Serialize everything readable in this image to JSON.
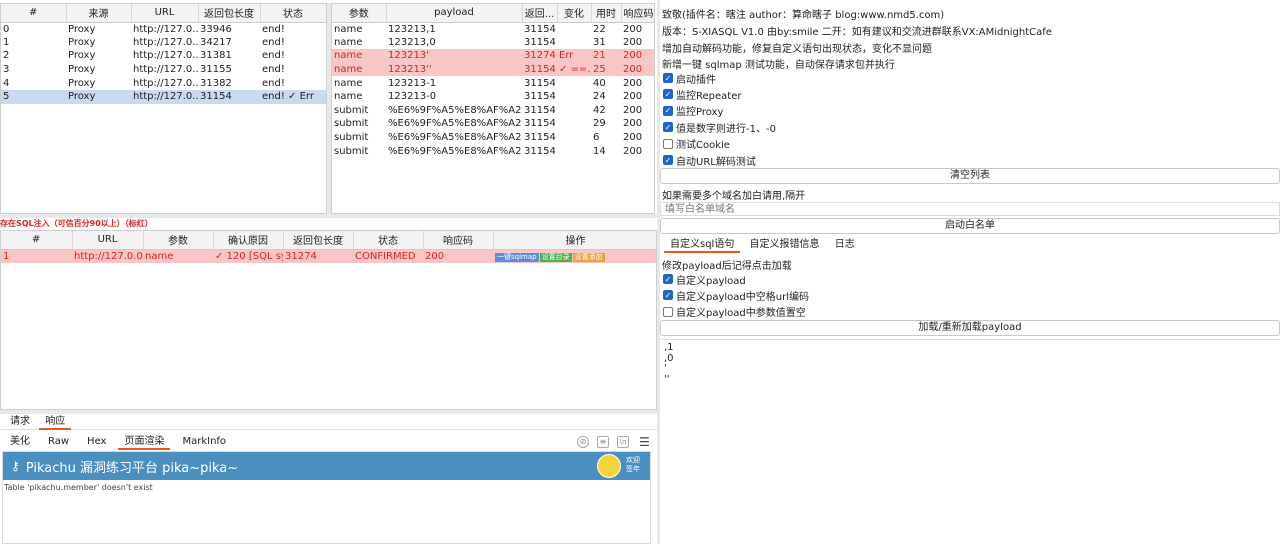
{
  "left_table": {
    "columns": [
      "#",
      "来源",
      "URL",
      "返回包长度",
      "状态"
    ],
    "rows": [
      [
        "0",
        "Proxy",
        "http://127.0...",
        "33946",
        "end!"
      ],
      [
        "1",
        "Proxy",
        "http://127.0...",
        "34217",
        "end!"
      ],
      [
        "2",
        "Proxy",
        "http://127.0...",
        "31381",
        "end!"
      ],
      [
        "3",
        "Proxy",
        "http://127.0...",
        "31155",
        "end!"
      ],
      [
        "4",
        "Proxy",
        "http://127.0...",
        "31382",
        "end!"
      ],
      [
        "5",
        "Proxy",
        "http://127.0...",
        "31154",
        "end! ✓ Err"
      ]
    ]
  },
  "payload_table": {
    "columns": [
      "参数",
      "payload",
      "返回...",
      "变化",
      "用时",
      "响应码"
    ],
    "rows": [
      [
        "name",
        "123213,1",
        "31154",
        "",
        "22",
        "200"
      ],
      [
        "name",
        "123213,0",
        "31154",
        "",
        "31",
        "200"
      ],
      [
        "name",
        "123213'",
        "31274",
        "Err",
        "21",
        "200"
      ],
      [
        "name",
        "123213''",
        "31154",
        "✓ ==...",
        "25",
        "200"
      ],
      [
        "name",
        "123213-1",
        "31154",
        "",
        "40",
        "200"
      ],
      [
        "name",
        "123213-0",
        "31154",
        "",
        "24",
        "200"
      ],
      [
        "submit",
        "%E6%9F%A5%E8%AF%A2,1",
        "31154",
        "",
        "42",
        "200"
      ],
      [
        "submit",
        "%E6%9F%A5%E8%AF%A2,0",
        "31154",
        "",
        "29",
        "200"
      ],
      [
        "submit",
        "%E6%9F%A5%E8%AF%A2'",
        "31154",
        "",
        "6",
        "200"
      ],
      [
        "submit",
        "%E6%9F%A5%E8%AF%A2''",
        "31154",
        "",
        "14",
        "200"
      ]
    ]
  },
  "vuln_notice": "存在SQL注入（可信百分90以上）（标红）",
  "vuln_table": {
    "columns": [
      "#",
      "URL",
      "参数",
      "确认原因",
      "返回包长度",
      "状态",
      "响应码",
      "操作"
    ],
    "rows": [
      [
        "1",
        "http://127.0.0....",
        "name",
        "✓ 120 [SQL sy...",
        "31274",
        "CONFIRMED",
        "200"
      ]
    ],
    "op_buttons": [
      "一键sqlmap",
      "设置目录",
      "设置添加"
    ]
  },
  "req_tabs": [
    "请求",
    "响应"
  ],
  "view_tabs": [
    "美化",
    "Raw",
    "Hex",
    "页面渲染",
    "MarkInfo"
  ],
  "rendered_page": {
    "banner_title": "Pikachu 漏洞练习平台 pika~pika~",
    "welcome_line1": "欢迎",
    "welcome_line2": "签年",
    "error_text": "Table 'pikachu.member' doesn't exist"
  },
  "right": {
    "info_lines": [
      "致敬(插件名：瞎注 author：算命瞎子 blog:www.nmd5.com)",
      "版本：S-XIASQL V1.0 由by:smile 二开：如有建议和交流进群联系VX:AMidnightCafe",
      "增加自动解码功能，修复自定义语句出现状态，变化不显问题",
      "新增一键 sqlmap 测试功能，自动保存请求包并执行"
    ],
    "checkboxes": [
      {
        "label": "启动插件",
        "checked": true
      },
      {
        "label": "监控Repeater",
        "checked": true
      },
      {
        "label": "监控Proxy",
        "checked": true
      },
      {
        "label": "值是数字则进行-1、-0",
        "checked": true
      },
      {
        "label": "测试Cookie",
        "checked": false
      },
      {
        "label": "自动URL解码测试",
        "checked": true
      }
    ],
    "clear_button": "清空列表",
    "whitelist_hint": "如果需要多个域名加白请用,隔开",
    "whitelist_placeholder": "填写白名单域名",
    "whitelist_button": "启动白名单",
    "custom_tabs": [
      "自定义sql语句",
      "自定义报错信息",
      "日志"
    ],
    "reload_hint": "修改payload后记得点击加载",
    "custom_checkboxes": [
      {
        "label": "自定义payload",
        "checked": true
      },
      {
        "label": "自定义payload中空格url编码",
        "checked": true
      },
      {
        "label": "自定义payload中参数值置空",
        "checked": false
      }
    ],
    "reload_button": "加载/重新加载payload",
    "payload_lines": [
      ",1",
      ",0",
      "'",
      "''"
    ]
  },
  "colors": {
    "error_row": "#f8c6c6",
    "selected_row": "#c9d9ef",
    "banner": "#4a8fc0",
    "checkbox": "#1e66c8",
    "accent_tab": "#e25a1c"
  }
}
